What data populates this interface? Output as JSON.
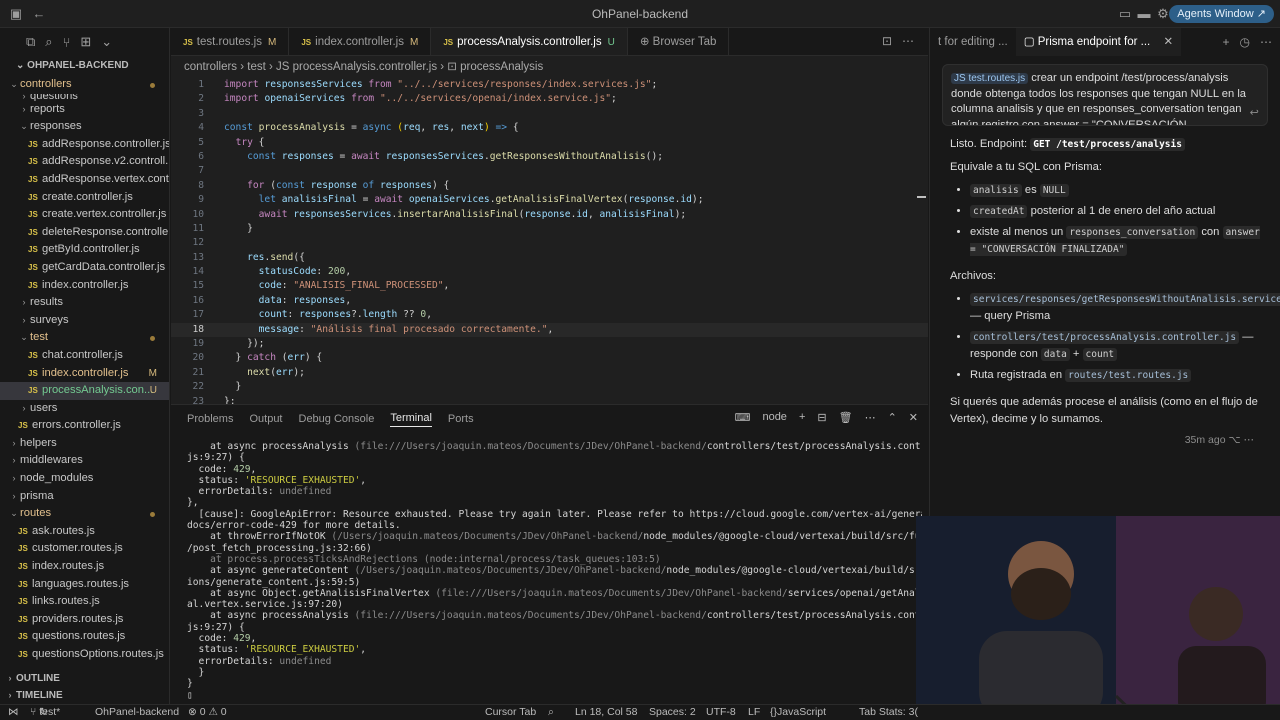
{
  "window": {
    "title": "OhPanel-backend",
    "agents_button": "Agents Window ↗"
  },
  "sidebar": {
    "header": "OHPANEL-BACKEND",
    "tree": [
      {
        "label": "controllers",
        "type": "folder",
        "open": true,
        "indent": 0,
        "dot": true,
        "mod": true
      },
      {
        "label": "questions",
        "type": "folder",
        "indent": 1,
        "partial": true
      },
      {
        "label": "reports",
        "type": "folder",
        "indent": 1
      },
      {
        "label": "responses",
        "type": "folder",
        "open": true,
        "indent": 1
      },
      {
        "label": "addResponse.controller.js",
        "type": "js",
        "indent": 2
      },
      {
        "label": "addResponse.v2.controll...",
        "type": "js",
        "indent": 2
      },
      {
        "label": "addResponse.vertex.cont...",
        "type": "js",
        "indent": 2
      },
      {
        "label": "create.controller.js",
        "type": "js",
        "indent": 2
      },
      {
        "label": "create.vertex.controller.js",
        "type": "js",
        "indent": 2
      },
      {
        "label": "deleteResponse.controlle...",
        "type": "js",
        "indent": 2
      },
      {
        "label": "getById.controller.js",
        "type": "js",
        "indent": 2
      },
      {
        "label": "getCardData.controller.js",
        "type": "js",
        "indent": 2
      },
      {
        "label": "index.controller.js",
        "type": "js",
        "indent": 2
      },
      {
        "label": "results",
        "type": "folder",
        "indent": 1
      },
      {
        "label": "surveys",
        "type": "folder",
        "indent": 1
      },
      {
        "label": "test",
        "type": "folder",
        "open": true,
        "indent": 1,
        "dot": true,
        "mod": true
      },
      {
        "label": "chat.controller.js",
        "type": "js",
        "indent": 2
      },
      {
        "label": "index.controller.js",
        "type": "js",
        "indent": 2,
        "badge": "M",
        "mod": true
      },
      {
        "label": "processAnalysis.con...",
        "type": "js",
        "indent": 2,
        "badge": "U",
        "new": true,
        "selected": true
      },
      {
        "label": "users",
        "type": "folder",
        "indent": 1
      },
      {
        "label": "errors.controller.js",
        "type": "js",
        "indent": 1
      },
      {
        "label": "helpers",
        "type": "folder",
        "indent": 0
      },
      {
        "label": "middlewares",
        "type": "folder",
        "indent": 0
      },
      {
        "label": "node_modules",
        "type": "folder",
        "indent": 0
      },
      {
        "label": "prisma",
        "type": "folder",
        "indent": 0
      },
      {
        "label": "routes",
        "type": "folder",
        "open": true,
        "indent": 0,
        "dot": true,
        "mod": true
      },
      {
        "label": "ask.routes.js",
        "type": "js",
        "indent": 1
      },
      {
        "label": "customer.routes.js",
        "type": "js",
        "indent": 1
      },
      {
        "label": "index.routes.js",
        "type": "js",
        "indent": 1
      },
      {
        "label": "languages.routes.js",
        "type": "js",
        "indent": 1
      },
      {
        "label": "links.routes.js",
        "type": "js",
        "indent": 1
      },
      {
        "label": "providers.routes.js",
        "type": "js",
        "indent": 1
      },
      {
        "label": "questions.routes.js",
        "type": "js",
        "indent": 1
      },
      {
        "label": "questionsOptions.routes.js",
        "type": "js",
        "indent": 1
      }
    ],
    "outline": "OUTLINE",
    "timeline": "TIMELINE"
  },
  "editor": {
    "tabs": [
      {
        "label": "test.routes.js",
        "flag": "M",
        "active": false
      },
      {
        "label": "index.controller.js",
        "flag": "M",
        "active": false
      },
      {
        "label": "processAnalysis.controller.js",
        "flag": "U",
        "active": true
      },
      {
        "label": "Browser Tab",
        "flag": "",
        "active": false,
        "globe": true
      }
    ],
    "breadcrumb": "controllers  ›  test  ›  JS processAnalysis.controller.js  ›  ⊡ processAnalysis",
    "current_line": 18
  },
  "panel": {
    "tabs": [
      "Problems",
      "Output",
      "Debug Console",
      "Terminal",
      "Ports"
    ],
    "active_tab": "Terminal",
    "shell": "node"
  },
  "chat": {
    "tabs": [
      "t for editing ...",
      "Prisma endpoint for ..."
    ],
    "prompt_chip": "JS test.routes.js",
    "prompt_text": " crear un endpoint  /test/process/analysis donde obtenga todos los responses que tengan NULL en la columna analisis y que en responses_conversation tengan algún registro con answer = \"CONVERSACIÓN",
    "intro": "Listo. Endpoint:",
    "endpoint": "GET /test/process/analysis",
    "equivale": "Equivale a tu SQL con Prisma:",
    "b1_code": "analisis",
    "b1_mid": " es ",
    "b1_code2": "NULL",
    "b2_code": "createdAt",
    "b2_text": " posterior al 1 de enero del año actual",
    "b3_text": "existe al menos un ",
    "b3_code": "responses_conversation",
    "b3_mid": " con ",
    "b3_code2": "answer = \"CONVERSACIÓN FINALIZADA\"",
    "archivos": "Archivos:",
    "f1_code": "services/responses/getResponsesWithoutAnalisis.service.js",
    "f1_text": " — query Prisma",
    "f2_code": "controllers/test/processAnalysis.controller.js",
    "f2_text": " — responde con ",
    "f2_code2": "data",
    "f2_plus": " + ",
    "f2_code3": "count",
    "f3_text": "Ruta registrada en ",
    "f3_code": "routes/test.routes.js",
    "closing": "Si querés que además procese el análisis (como en el flujo de Vertex), decime y lo sumamos.",
    "age": "35m ago"
  },
  "statusbar": {
    "branch": "test*",
    "project": "OhPanel-backend",
    "problems": "⊗ 0  ⚠ 0",
    "cursor_tab": "Cursor Tab",
    "position": "Ln 18, Col 58",
    "spaces": "Spaces: 2",
    "encoding": "UTF-8",
    "eol": "LF",
    "language": "JavaScript",
    "tab_stats": "Tab Stats: 3("
  },
  "code_lines": [
    [
      [
        "kw",
        "import "
      ],
      [
        "var",
        "responsesServices "
      ],
      [
        "kw",
        "from "
      ],
      [
        "str",
        "\"../../services/responses/index.services.js\""
      ],
      [
        "pl",
        ";"
      ]
    ],
    [
      [
        "kw",
        "import "
      ],
      [
        "var",
        "openaiServices "
      ],
      [
        "kw",
        "from "
      ],
      [
        "str",
        "\"../../services/openai/index.service.js\""
      ],
      [
        "pl",
        ";"
      ]
    ],
    [],
    [
      [
        "kb",
        "const "
      ],
      [
        "fn",
        "processAnalysis"
      ],
      [
        "pl",
        " = "
      ],
      [
        "kb",
        "async "
      ],
      [
        "par",
        "("
      ],
      [
        "var",
        "req"
      ],
      [
        "pl",
        ", "
      ],
      [
        "var",
        "res"
      ],
      [
        "pl",
        ", "
      ],
      [
        "var",
        "next"
      ],
      [
        "par",
        ")"
      ],
      [
        "pl",
        " "
      ],
      [
        "kb",
        "=>"
      ],
      [
        "pl",
        " {"
      ]
    ],
    [
      [
        "pl",
        "  "
      ],
      [
        "kw",
        "try"
      ],
      [
        "pl",
        " {"
      ]
    ],
    [
      [
        "pl",
        "    "
      ],
      [
        "kb",
        "const "
      ],
      [
        "var",
        "responses"
      ],
      [
        "pl",
        " = "
      ],
      [
        "kw",
        "await "
      ],
      [
        "var",
        "responsesServices"
      ],
      [
        "pl",
        "."
      ],
      [
        "fn",
        "getResponsesWithoutAnalisis"
      ],
      [
        "pl",
        "();"
      ]
    ],
    [],
    [
      [
        "pl",
        "    "
      ],
      [
        "kw",
        "for "
      ],
      [
        "pl",
        "("
      ],
      [
        "kb",
        "const "
      ],
      [
        "var",
        "response "
      ],
      [
        "kb",
        "of "
      ],
      [
        "var",
        "responses"
      ],
      [
        "pl",
        ") {"
      ]
    ],
    [
      [
        "pl",
        "      "
      ],
      [
        "kb",
        "let "
      ],
      [
        "var",
        "analisisFinal"
      ],
      [
        "pl",
        " = "
      ],
      [
        "kw",
        "await "
      ],
      [
        "var",
        "openaiServices"
      ],
      [
        "pl",
        "."
      ],
      [
        "fn",
        "getAnalisisFinalVertex"
      ],
      [
        "pl",
        "("
      ],
      [
        "var",
        "response"
      ],
      [
        "pl",
        "."
      ],
      [
        "var",
        "id"
      ],
      [
        "pl",
        ");"
      ]
    ],
    [
      [
        "pl",
        "      "
      ],
      [
        "kw",
        "await "
      ],
      [
        "var",
        "responsesServices"
      ],
      [
        "pl",
        "."
      ],
      [
        "fn",
        "insertarAnalisisFinal"
      ],
      [
        "pl",
        "("
      ],
      [
        "var",
        "response"
      ],
      [
        "pl",
        "."
      ],
      [
        "var",
        "id"
      ],
      [
        "pl",
        ", "
      ],
      [
        "var",
        "analisisFinal"
      ],
      [
        "pl",
        ");"
      ]
    ],
    [
      [
        "pl",
        "    }"
      ]
    ],
    [],
    [
      [
        "pl",
        "    "
      ],
      [
        "var",
        "res"
      ],
      [
        "pl",
        "."
      ],
      [
        "fn",
        "send"
      ],
      [
        "pl",
        "({"
      ]
    ],
    [
      [
        "pl",
        "      "
      ],
      [
        "var",
        "statusCode"
      ],
      [
        "pl",
        ": "
      ],
      [
        "num",
        "200"
      ],
      [
        "pl",
        ","
      ]
    ],
    [
      [
        "pl",
        "      "
      ],
      [
        "var",
        "code"
      ],
      [
        "pl",
        ": "
      ],
      [
        "str",
        "\"ANALISIS_FINAL_PROCESSED\""
      ],
      [
        "pl",
        ","
      ]
    ],
    [
      [
        "pl",
        "      "
      ],
      [
        "var",
        "data"
      ],
      [
        "pl",
        ": "
      ],
      [
        "var",
        "responses"
      ],
      [
        "pl",
        ","
      ]
    ],
    [
      [
        "pl",
        "      "
      ],
      [
        "var",
        "count"
      ],
      [
        "pl",
        ": "
      ],
      [
        "var",
        "responses"
      ],
      [
        "pl",
        "?."
      ],
      [
        "var",
        "length"
      ],
      [
        "pl",
        " ?? "
      ],
      [
        "num",
        "0"
      ],
      [
        "pl",
        ","
      ]
    ],
    [
      [
        "pl",
        "      "
      ],
      [
        "var",
        "message"
      ],
      [
        "pl",
        ": "
      ],
      [
        "str",
        "\"Análisis final procesado correctamente.\""
      ],
      [
        "pl",
        ","
      ]
    ],
    [
      [
        "pl",
        "    });"
      ]
    ],
    [
      [
        "pl",
        "  } "
      ],
      [
        "kw",
        "catch "
      ],
      [
        "pl",
        "("
      ],
      [
        "var",
        "err"
      ],
      [
        "pl",
        ") {"
      ]
    ],
    [
      [
        "pl",
        "    "
      ],
      [
        "fn",
        "next"
      ],
      [
        "pl",
        "("
      ],
      [
        "var",
        "err"
      ],
      [
        "pl",
        ");"
      ]
    ],
    [
      [
        "pl",
        "  }"
      ]
    ],
    [
      [
        "pl",
        "};"
      ]
    ]
  ],
  "terminal_lines": [
    [
      [
        "pl",
        "    at async processAnalysis "
      ],
      [
        "dim",
        "(file:///Users/joaquin.mateos/Documents/JDev/OhPanel-backend/"
      ],
      [
        "pl",
        "controllers/test/processAnalysis.controller."
      ]
    ],
    [
      [
        "pl",
        "js:9:27) {"
      ]
    ],
    [
      [
        "pl",
        "  code: "
      ],
      [
        "g",
        "429"
      ],
      [
        "pl",
        ","
      ]
    ],
    [
      [
        "pl",
        "  status: "
      ],
      [
        "y",
        "'RESOURCE_EXHAUSTED'"
      ],
      [
        "pl",
        ","
      ]
    ],
    [
      [
        "pl",
        "  errorDetails: "
      ],
      [
        "dim",
        "undefined"
      ]
    ],
    [
      [
        "pl",
        "},"
      ]
    ],
    [
      [
        "pl",
        "  [cause]: GoogleApiError: Resource exhausted. Please try again later. Please refer to https://cloud.google.com/vertex-ai/generative-ai/"
      ]
    ],
    [
      [
        "pl",
        "docs/error-code-429 for more details."
      ]
    ],
    [
      [
        "pl",
        "    at throwErrorIfNotOK "
      ],
      [
        "dim",
        "(/Users/joaquin.mateos/Documents/JDev/OhPanel-backend/"
      ],
      [
        "pl",
        "node_modules/@google-cloud/vertexai/build/src/functions"
      ]
    ],
    [
      [
        "pl",
        "/post_fetch_processing.js:32:66)"
      ]
    ],
    [
      [
        "dim",
        "    at process.processTicksAndRejections (node:internal/process/task_queues:103:5)"
      ]
    ],
    [
      [
        "pl",
        "    at async generateContent "
      ],
      [
        "dim",
        "(/Users/joaquin.mateos/Documents/JDev/OhPanel-backend/"
      ],
      [
        "pl",
        "node_modules/@google-cloud/vertexai/build/src/funct"
      ]
    ],
    [
      [
        "pl",
        "ions/generate_content.js:59:5)"
      ]
    ],
    [
      [
        "pl",
        "    at async Object.getAnalisisFinalVertex "
      ],
      [
        "dim",
        "(file:///Users/joaquin.mateos/Documents/JDev/OhPanel-backend/"
      ],
      [
        "pl",
        "services/openai/getAnalisisFin"
      ]
    ],
    [
      [
        "pl",
        "al.vertex.service.js:97:20)"
      ]
    ],
    [
      [
        "pl",
        "    at async processAnalysis "
      ],
      [
        "dim",
        "(file:///Users/joaquin.mateos/Documents/JDev/OhPanel-backend/"
      ],
      [
        "pl",
        "controllers/test/processAnalysis.controller."
      ]
    ],
    [
      [
        "pl",
        "js:9:27) {"
      ]
    ],
    [
      [
        "pl",
        "  code: "
      ],
      [
        "g",
        "429"
      ],
      [
        "pl",
        ","
      ]
    ],
    [
      [
        "pl",
        "  status: "
      ],
      [
        "y",
        "'RESOURCE_EXHAUSTED'"
      ],
      [
        "pl",
        ","
      ]
    ],
    [
      [
        "pl",
        "  errorDetails: "
      ],
      [
        "dim",
        "undefined"
      ]
    ],
    [
      [
        "pl",
        "  }"
      ]
    ],
    [
      [
        "pl",
        "}"
      ]
    ],
    [
      [
        "pl",
        "▯"
      ]
    ]
  ]
}
